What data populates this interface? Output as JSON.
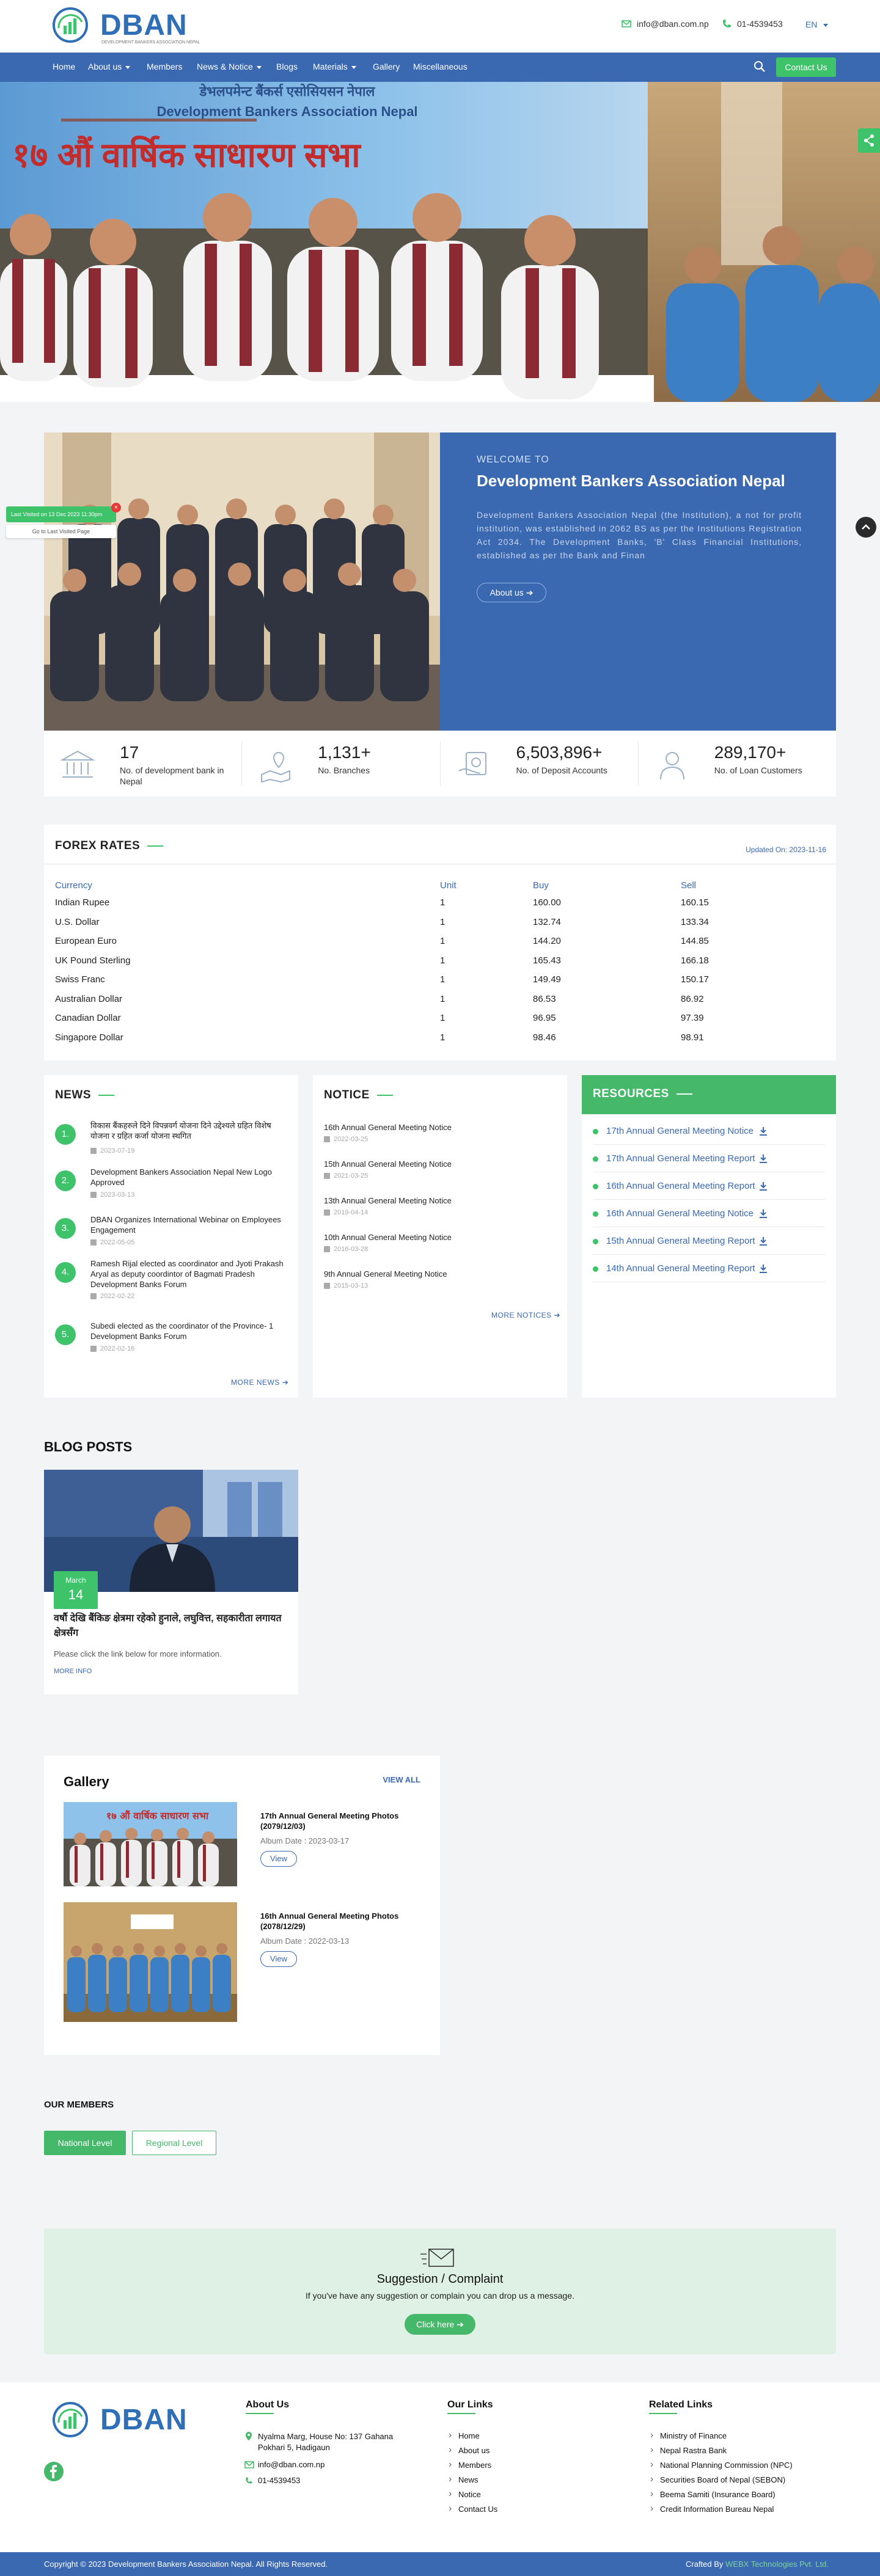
{
  "header": {
    "logo_text": "DBAN",
    "logo_subtext": "DEVELOPMENT BANKERS ASSOCIATION NEPAL",
    "email": "info@dban.com.np",
    "phone": "01-4539453",
    "language": "EN"
  },
  "nav": {
    "items": [
      {
        "label": "Home"
      },
      {
        "label": "About us"
      },
      {
        "label": "Members"
      },
      {
        "label": "News & Notice"
      },
      {
        "label": "Blogs"
      },
      {
        "label": "Materials"
      },
      {
        "label": "Gallery"
      },
      {
        "label": "Miscellaneous"
      }
    ],
    "contact_label": "Contact Us"
  },
  "hero": {
    "banner_line1": "डेभलपमेन्ट बैंकर्स एसोसियसन नेपाल",
    "banner_line2": "Development Bankers Association Nepal",
    "banner_title": "१७ औं वार्षिक साधारण सभा"
  },
  "visit_badge": {
    "label": "Last Visited on 13 Dec 2023 11:30pm",
    "link": "Go to Last Visited Page"
  },
  "welcome": {
    "kicker": "WELCOME TO",
    "title": "Development Bankers Association Nepal",
    "body": "Development Bankers Association Nepal (the Institution), a not for profit institution, was established in 2062 BS as per the Institutions Registration Act 2034. The Development Banks, 'B' Class Financial Institutions, established as per the Bank and Finan",
    "button": "About us"
  },
  "stats": [
    {
      "value": "17",
      "label": "No. of development bank in Nepal",
      "icon": "bank-icon"
    },
    {
      "value": "1,131+",
      "label": "No. Branches",
      "icon": "map-pin-icon"
    },
    {
      "value": "6,503,896+",
      "label": "No. of Deposit Accounts",
      "icon": "deposit-icon"
    },
    {
      "value": "289,170+",
      "label": "No. of Loan Customers",
      "icon": "customers-icon"
    }
  ],
  "forex": {
    "title": "FOREX RATES",
    "updated": "Updated On: 2023-11-16",
    "headers": [
      "Currency",
      "Unit",
      "Buy",
      "Sell"
    ],
    "rows": [
      [
        "Indian Rupee",
        "1",
        "160.00",
        "160.15"
      ],
      [
        "U.S. Dollar",
        "1",
        "132.74",
        "133.34"
      ],
      [
        "European Euro",
        "1",
        "144.20",
        "144.85"
      ],
      [
        "UK Pound Sterling",
        "1",
        "165.43",
        "166.18"
      ],
      [
        "Swiss Franc",
        "1",
        "149.49",
        "150.17"
      ],
      [
        "Australian Dollar",
        "1",
        "86.53",
        "86.92"
      ],
      [
        "Canadian Dollar",
        "1",
        "96.95",
        "97.39"
      ],
      [
        "Singapore Dollar",
        "1",
        "98.46",
        "98.91"
      ]
    ]
  },
  "news": {
    "title": "NEWS",
    "items": [
      {
        "n": "1.",
        "text": "विकास बैंकहरुले दिने विपन्नवर्ग योजना दिने उद्देश्यले ग्रहित विशेष योजना र ग्रहित कर्जा योजना स्थगित",
        "date": "2023-07-19"
      },
      {
        "n": "2.",
        "text": "Development Bankers Association Nepal New Logo Approved",
        "date": "2023-03-13"
      },
      {
        "n": "3.",
        "text": "DBAN Organizes International Webinar on Employees Engagement",
        "date": "2022-05-05"
      },
      {
        "n": "4.",
        "text": "Ramesh Rijal elected as coordinator and Jyoti Prakash Aryal as deputy coordintor of Bagmati Pradesh Development Banks Forum",
        "date": "2022-02-22"
      },
      {
        "n": "5.",
        "text": "Subedi elected as the coordinator of the Province- 1 Development Banks Forum",
        "date": "2022-02-16"
      }
    ],
    "more": "MORE NEWS"
  },
  "notice": {
    "title": "NOTICE",
    "items": [
      {
        "text": "16th Annual General Meeting Notice",
        "date": "2022-03-25"
      },
      {
        "text": "15th Annual General Meeting Notice",
        "date": "2021-03-25"
      },
      {
        "text": "13th Annual General Meeting Notice",
        "date": "2019-04-14"
      },
      {
        "text": "10th Annual General Meeting Notice",
        "date": "2016-03-28"
      },
      {
        "text": "9th Annual General Meeting Notice",
        "date": "2015-03-13"
      }
    ],
    "more": "MORE NOTICES"
  },
  "resources": {
    "title": "RESOURCES",
    "items": [
      "17th Annual General Meeting Notice",
      "17th Annual General Meeting Report",
      "16th Annual General Meeting Report",
      "16th Annual General Meeting Notice",
      "15th Annual General Meeting Report",
      "14th Annual General Meeting Report"
    ]
  },
  "blog": {
    "section_title": "BLOG POSTS",
    "month": "March",
    "day": "14",
    "title": "वर्षौ देखि बैंकिङ क्षेत्रमा रहेको हुनाले, लघुवित्त, सहकारीता लगायत क्षेत्रसँग",
    "excerpt": "Please click the link below for more information.",
    "more": "MORE INFO"
  },
  "gallery": {
    "title": "Gallery",
    "view_all": "VIEW ALL",
    "items": [
      {
        "title": "17th Annual General Meeting Photos (2079/12/03)",
        "date": "Album Date : 2023-03-17",
        "button": "View"
      },
      {
        "title": "16th Annual General Meeting Photos (2078/12/29)",
        "date": "Album Date : 2022-03-13",
        "button": "View"
      }
    ]
  },
  "members": {
    "title": "OUR MEMBERS",
    "national": "National Level",
    "regional": "Regional Level"
  },
  "suggestion": {
    "title": "Suggestion / Complaint",
    "text": "If you've have any suggestion or complain you can drop us a message.",
    "button": "Click here"
  },
  "footer": {
    "about_title": "About Us",
    "address": "Nyalma Marg, House No: 137 Gahana Pokhari 5, Hadigaun",
    "email": "info@dban.com.np",
    "phone": "01-4539453",
    "links_title": "Our Links",
    "links": [
      "Home",
      "About us",
      "Members",
      "News",
      "Notice",
      "Contact Us"
    ],
    "related_title": "Related Links",
    "related": [
      "Ministry of Finance",
      "Nepal Rastra Bank",
      "National Planning Commission (NPC)",
      "Securities Board of Nepal (SEBON)",
      "Beema Samiti (Insurance Board)",
      "Credit Information Bureau Nepal"
    ],
    "copyright": "Copyright © 2023 Development Bankers Association Nepal. All Rights Reserved.",
    "crafted_prefix": "Crafted By",
    "crafted_by": "WEBX Technologies Pvt. Ltd."
  },
  "colors": {
    "primary": "#3a68b1",
    "accent": "#3ec36b"
  }
}
